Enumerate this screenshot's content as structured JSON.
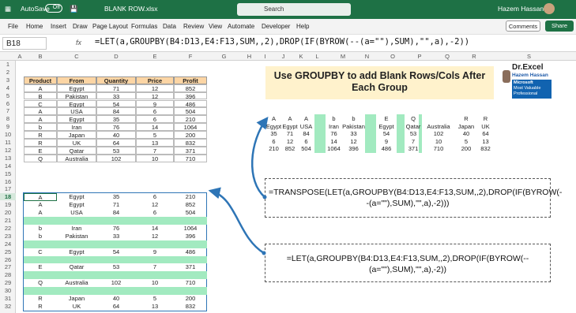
{
  "titlebar": {
    "autosave": "AutoSave",
    "toggle": "Off",
    "filename": "BLANK ROW.xlsx",
    "search": "Search",
    "user": "Hazem Hassan"
  },
  "ribbon": {
    "tabs": [
      "File",
      "Home",
      "Insert",
      "Draw",
      "Page Layout",
      "Formulas",
      "Data",
      "Review",
      "View",
      "Automate",
      "Developer",
      "Help"
    ],
    "comments": "Comments",
    "share": "Share"
  },
  "formulabar": {
    "namebox": "B18",
    "fx": "fx",
    "formula": "=LET(a,GROUPBY(B4:D13,E4:F13,SUM,,2),DROP(IF(BYROW(--(a=\"\"),SUM),\"\",a),-2))"
  },
  "columns": [
    "A",
    "B",
    "C",
    "D",
    "E",
    "F",
    "G",
    "H",
    "I",
    "J",
    "K",
    "L",
    "M",
    "N",
    "O",
    "P",
    "Q",
    "R",
    "S"
  ],
  "rows": [
    "1",
    "2",
    "3",
    "4",
    "5",
    "6",
    "7",
    "8",
    "9",
    "10",
    "11",
    "12",
    "13",
    "14",
    "15",
    "16",
    "17",
    "18",
    "19",
    "20",
    "21",
    "22",
    "23",
    "24",
    "25",
    "26",
    "27",
    "28",
    "29",
    "30",
    "31",
    "32"
  ],
  "source_table": {
    "headers": [
      "Product",
      "From",
      "Quantity",
      "Price",
      "Profit"
    ],
    "rows": [
      [
        "A",
        "Egypt",
        "71",
        "12",
        "852"
      ],
      [
        "B",
        "Pakistan",
        "33",
        "12",
        "396"
      ],
      [
        "C",
        "Egypt",
        "54",
        "9",
        "486"
      ],
      [
        "A",
        "USA",
        "84",
        "6",
        "504"
      ],
      [
        "A",
        "Egypt",
        "35",
        "6",
        "210"
      ],
      [
        "b",
        "Iran",
        "76",
        "14",
        "1064"
      ],
      [
        "R",
        "Japan",
        "40",
        "5",
        "200"
      ],
      [
        "R",
        "UK",
        "64",
        "13",
        "832"
      ],
      [
        "E",
        "Qatar",
        "53",
        "7",
        "371"
      ],
      [
        "Q",
        "Australia",
        "102",
        "10",
        "710"
      ]
    ]
  },
  "banner": {
    "title": "Use GROUPBY to add Blank Rows/Cols After Each Group"
  },
  "logo": {
    "name": "Dr.Excel",
    "person": "Hazem Hassan",
    "mvp1": "Microsoft",
    "mvp2": "Most Valuable",
    "mvp3": "Professional"
  },
  "transposed": {
    "row1": [
      "A",
      "A",
      "A",
      "",
      "b",
      "b",
      "",
      "E",
      "",
      "Q",
      "",
      "R",
      "R"
    ],
    "row2": [
      "Egypt",
      "Egypt",
      "USA",
      "",
      "Iran",
      "Pakistan",
      "",
      "Egypt",
      "",
      "Qatar",
      "Australia",
      "Japan",
      "UK"
    ],
    "row3": [
      "35",
      "71",
      "84",
      "",
      "76",
      "33",
      "",
      "54",
      "",
      "53",
      "102",
      "40",
      "64"
    ],
    "row4": [
      "6",
      "12",
      "6",
      "",
      "14",
      "12",
      "",
      "9",
      "",
      "7",
      "10",
      "5",
      "13"
    ],
    "row5": [
      "210",
      "852",
      "504",
      "",
      "1064",
      "396",
      "",
      "486",
      "",
      "371",
      "710",
      "200",
      "832"
    ]
  },
  "result_table": {
    "rows": [
      [
        "A",
        "Egypt",
        "35",
        "6",
        "210"
      ],
      [
        "A",
        "Egypt",
        "71",
        "12",
        "852"
      ],
      [
        "A",
        "USA",
        "84",
        "6",
        "504"
      ],
      [
        "",
        "",
        "",
        "",
        ""
      ],
      [
        "b",
        "Iran",
        "76",
        "14",
        "1064"
      ],
      [
        "b",
        "Pakistan",
        "33",
        "12",
        "396"
      ],
      [
        "",
        "",
        "",
        "",
        ""
      ],
      [
        "C",
        "Egypt",
        "54",
        "9",
        "486"
      ],
      [
        "",
        "",
        "",
        "",
        ""
      ],
      [
        "E",
        "Qatar",
        "53",
        "7",
        "371"
      ],
      [
        "",
        "",
        "",
        "",
        ""
      ],
      [
        "Q",
        "Australia",
        "102",
        "10",
        "710"
      ],
      [
        "",
        "",
        "",
        "",
        ""
      ],
      [
        "R",
        "Japan",
        "40",
        "5",
        "200"
      ],
      [
        "R",
        "UK",
        "64",
        "13",
        "832"
      ]
    ]
  },
  "formula_boxes": {
    "transpose": "=TRANSPOSE(LET(a,GROUPBY(B4:D13,E4:F13,SUM,,2),DROP(IF(BYROW(--(a=\"\"),SUM),\"\",a),-2)))",
    "let": "=LET(a,GROUPBY(B4:D13,E4:F13,SUM,,2),DROP(IF(BYROW(--(a=\"\"),SUM),\"\",a),-2))"
  },
  "colors": {
    "header": "#fcd5a4",
    "blank_row": "#a2eac0",
    "excel_green": "#1e7145",
    "arrow": "#2e75b6"
  }
}
